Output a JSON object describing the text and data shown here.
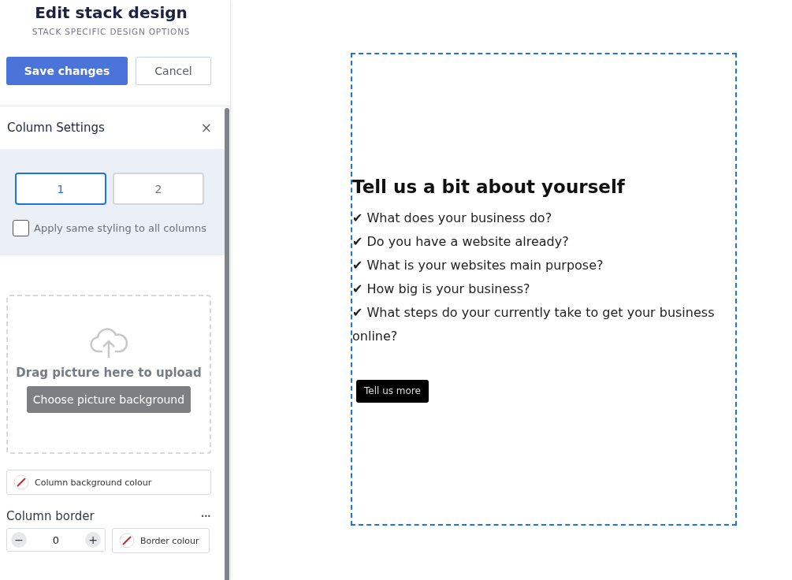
{
  "header": {
    "title": "Edit stack design",
    "subtitle": "STACK SPECIFIC DESIGN OPTIONS"
  },
  "actions": {
    "save": "Save changes",
    "cancel": "Cancel"
  },
  "column_settings": {
    "title": "Column Settings",
    "close": "×",
    "columns": [
      {
        "label": "1",
        "selected": true
      },
      {
        "label": "2",
        "selected": false
      }
    ],
    "apply_all": {
      "label": "Apply same styling to all columns",
      "checked": false
    }
  },
  "upload": {
    "hint": "Drag picture here to upload",
    "button": "Choose picture background"
  },
  "background_colour": {
    "label": "Column background colour"
  },
  "border": {
    "title": "Column border",
    "more": "•••",
    "minus": "−",
    "value": "0",
    "plus": "+",
    "colour": "Border colour"
  },
  "preview": {
    "heading": "Tell us a bit about yourself",
    "lines": [
      "✔ What does your business do?",
      "✔ Do you have a website already?",
      "✔ What is your websites main purpose?",
      "✔ How big is your business?",
      "✔ What steps do your currently take to get your business online?"
    ],
    "button": "Tell us more"
  }
}
